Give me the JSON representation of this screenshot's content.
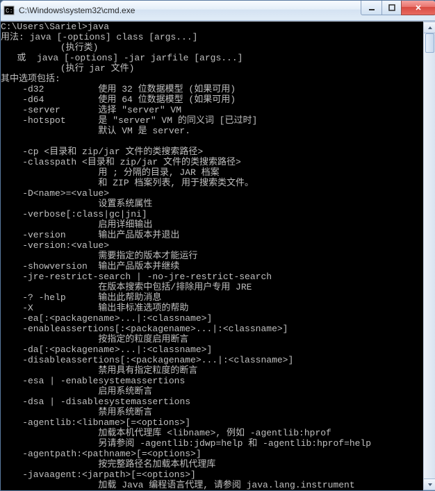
{
  "window": {
    "title": "C:\\Windows\\system32\\cmd.exe"
  },
  "terminal": {
    "text": "C:\\Users\\Sariel>java\n用法: java [-options] class [args...]\n           (执行类)\n   或  java [-options] -jar jarfile [args...]\n           (执行 jar 文件)\n其中选项包括:\n    -d32          使用 32 位数据模型 (如果可用)\n    -d64          使用 64 位数据模型 (如果可用)\n    -server       选择 \"server\" VM\n    -hotspot      是 \"server\" VM 的同义词 [已过时]\n                  默认 VM 是 server.\n\n    -cp <目录和 zip/jar 文件的类搜索路径>\n    -classpath <目录和 zip/jar 文件的类搜索路径>\n                  用 ; 分隔的目录, JAR 档案\n                  和 ZIP 档案列表, 用于搜索类文件。\n    -D<name>=<value>\n                  设置系统属性\n    -verbose[:class|gc|jni]\n                  启用详细输出\n    -version      输出产品版本并退出\n    -version:<value>\n                  需要指定的版本才能运行\n    -showversion  输出产品版本并继续\n    -jre-restrict-search | -no-jre-restrict-search\n                  在版本搜索中包括/排除用户专用 JRE\n    -? -help      输出此帮助消息\n    -X            输出非标准选项的帮助\n    -ea[:<packagename>...|:<classname>]\n    -enableassertions[:<packagename>...|:<classname>]\n                  按指定的粒度启用断言\n    -da[:<packagename>...|:<classname>]\n    -disableassertions[:<packagename>...|:<classname>]\n                  禁用具有指定粒度的断言\n    -esa | -enablesystemassertions\n                  启用系统断言\n    -dsa | -disablesystemassertions\n                  禁用系统断言\n    -agentlib:<libname>[=<options>]\n                  加载本机代理库 <libname>, 例如 -agentlib:hprof\n                  另请参阅 -agentlib:jdwp=help 和 -agentlib:hprof=help\n    -agentpath:<pathname>[=<options>]\n                  按完整路径名加载本机代理库\n    -javaagent:<jarpath>[=<options>]\n                  加载 Java 编程语言代理, 请参阅 java.lang.instrument"
  }
}
